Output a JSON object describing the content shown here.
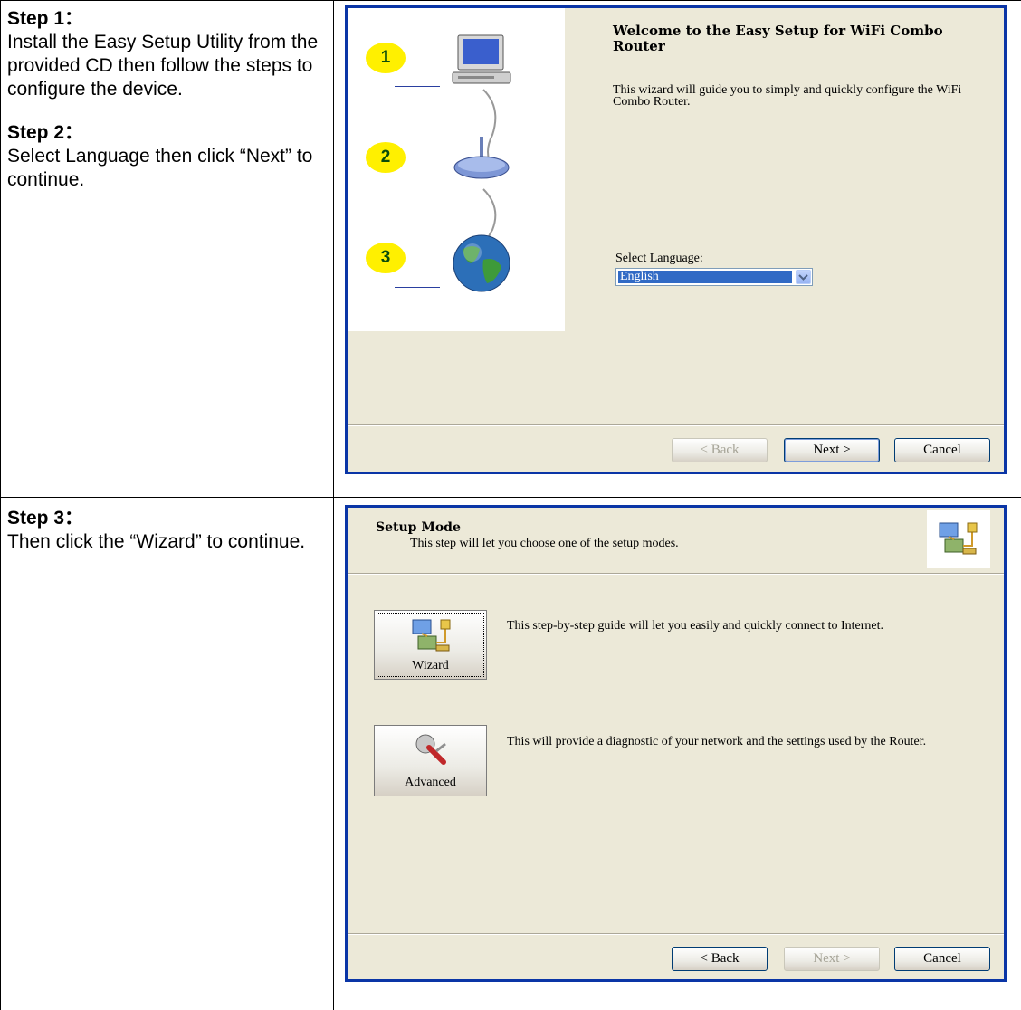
{
  "steps": [
    {
      "head": "Step 1：",
      "body": "Install the Easy Setup Utility from the provided CD then follow the steps to configure the device."
    },
    {
      "head": "Step 2：",
      "body": "Select Language then click “Next” to continue."
    },
    {
      "head": "Step 3：",
      "body": "Then click the “Wizard” to continue."
    }
  ],
  "welcome_dialog": {
    "title": "Welcome to the Easy Setup for WiFi Combo Router",
    "description": "This wizard will guide you to simply and quickly configure the WiFi Combo Router.",
    "language_label": "Select Language:",
    "language_value": "English",
    "badges": [
      "1",
      "2",
      "3"
    ],
    "buttons": {
      "back": "< Back",
      "next": "Next >",
      "cancel": "Cancel"
    }
  },
  "setup_dialog": {
    "title": "Setup Mode",
    "subtitle": "This step will let you choose one of the setup modes.",
    "wizard": {
      "label": "Wizard",
      "description": "This step-by-step guide will let you easily and quickly connect to Internet."
    },
    "advanced": {
      "label": "Advanced",
      "description": "This will provide a diagnostic of your network and the settings used by the Router."
    },
    "buttons": {
      "back": "< Back",
      "next": "Next >",
      "cancel": "Cancel"
    }
  },
  "colors": {
    "dialog_bg": "#ECE9D8",
    "frame": "#0A35A6",
    "selection": "#316AC5",
    "badge": "#FFF000"
  }
}
